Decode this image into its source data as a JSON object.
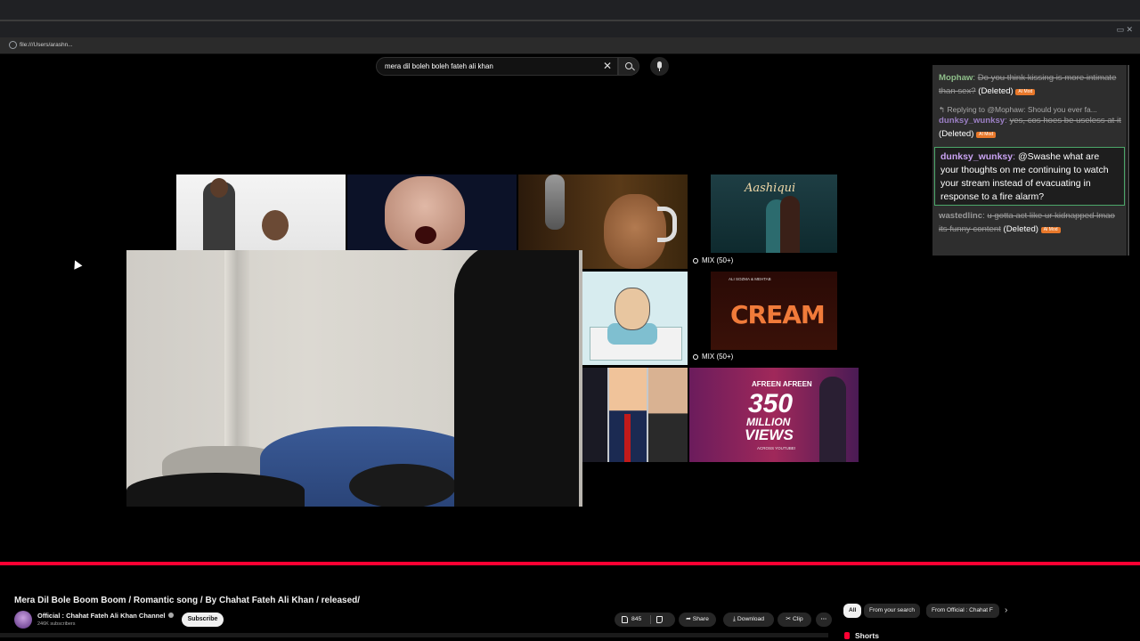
{
  "browser": {
    "url": "file:///Users/arashn..."
  },
  "search": {
    "query": "mera dil boleh boleh fateh ali khan"
  },
  "thumbnails": {
    "mix_label_1": "MIX (50+)",
    "mix_label_2": "MIX (50+)",
    "thumb4_title": "Aashiqui",
    "thumb6_small": "ALI SOZMA & MEHTAB",
    "thumb6_title": "CREAM",
    "thumb8_top": "AFREEN AFREEN",
    "thumb8_num": "350",
    "thumb8_mil": "MILLION",
    "thumb8_views": "VIEWS",
    "thumb8_sub": "ACROSS YOUTUBE!"
  },
  "chat": {
    "messages": [
      {
        "user": "Mophaw",
        "user_color": "#8fbf8a",
        "text": "Do you think kissing is more intimate than sex?",
        "status": "(Deleted)",
        "badge": "AI Mod"
      },
      {
        "reply_to": "Replying to @Mophaw: Should you ever fa...",
        "user": "dunksy_wunksy",
        "user_color": "#b08ad8",
        "text": "yes, cos hoes be useless at it",
        "status": "(Deleted)",
        "badge": "AI Mod"
      },
      {
        "user": "dunksy_wunksy",
        "user_color": "#c9a2f2",
        "text": "@Swashe what are your thoughts on me continuing to watch your stream instead of evacuating in response to a fire alarm?"
      },
      {
        "user": "wastedlinc",
        "user_color": "#9a9a9a",
        "text": "u gotta act like ur kidnapped lmao its funny content",
        "status": "(Deleted)",
        "badge": "AI Mod"
      }
    ]
  },
  "video": {
    "title": "Mera Dil Bole Boom Boom / Romantic song / By Chahat Fateh Ali Khan / released/",
    "channel": "Official : Chahat Fateh Ali Khan Channel",
    "subscribers": "246K subscribers",
    "subscribe_label": "Subscribe",
    "likes": "845",
    "share_label": "Share",
    "download_label": "Download",
    "clip_label": "Clip",
    "more_label": "···"
  },
  "chips": {
    "all": "All",
    "from_search": "From your search",
    "from_channel": "From Official : Chahat F",
    "next": "›"
  },
  "shelf": {
    "shorts": "Shorts"
  },
  "colors": {
    "progress": "#ff0033",
    "highlight_border": "#4ca86a",
    "badge": "#e8782a"
  }
}
